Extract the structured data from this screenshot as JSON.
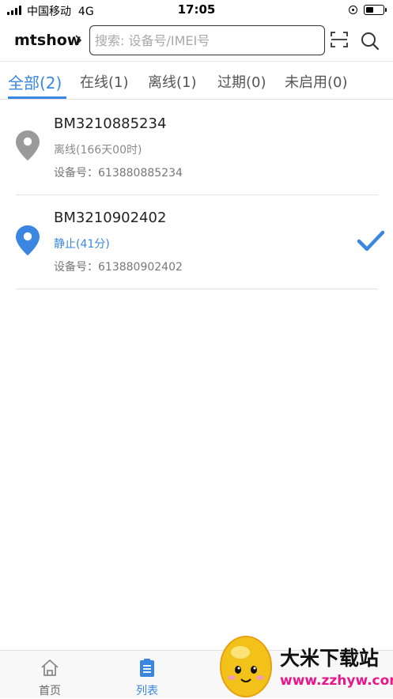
{
  "status_bar": {
    "carrier": "中国移动",
    "network": "4G",
    "time": "17:05"
  },
  "header": {
    "app_name": "mtshow",
    "search_placeholder": "搜索: 设备号/IMEI号"
  },
  "tabs": [
    {
      "label": "全部(2)",
      "active": true
    },
    {
      "label": "在线(1)",
      "active": false
    },
    {
      "label": "离线(1)",
      "active": false
    },
    {
      "label": "过期(0)",
      "active": false
    },
    {
      "label": "未启用(0)",
      "active": false
    }
  ],
  "devices": [
    {
      "name": "BM3210885234",
      "status": "离线(166天00时)",
      "device_id": "设备号：613880885234",
      "status_color": "#8a8a8a",
      "pin_color": "#9a9a9a",
      "selected": false
    },
    {
      "name": "BM3210902402",
      "status": "静止(41分)",
      "device_id": "设备号：613880902402",
      "status_color": "#3a86e0",
      "pin_color": "#3a86e0",
      "selected": true
    }
  ],
  "bottom_nav": {
    "items": [
      {
        "label": "首页",
        "icon": "home-icon",
        "active": false
      },
      {
        "label": "列表",
        "icon": "list-icon",
        "active": true
      }
    ]
  },
  "watermark": {
    "text": "大米下载站",
    "url": "www.zzhyw.com"
  },
  "colors": {
    "accent": "#3a86e0",
    "inactive": "#9a9a9a"
  }
}
